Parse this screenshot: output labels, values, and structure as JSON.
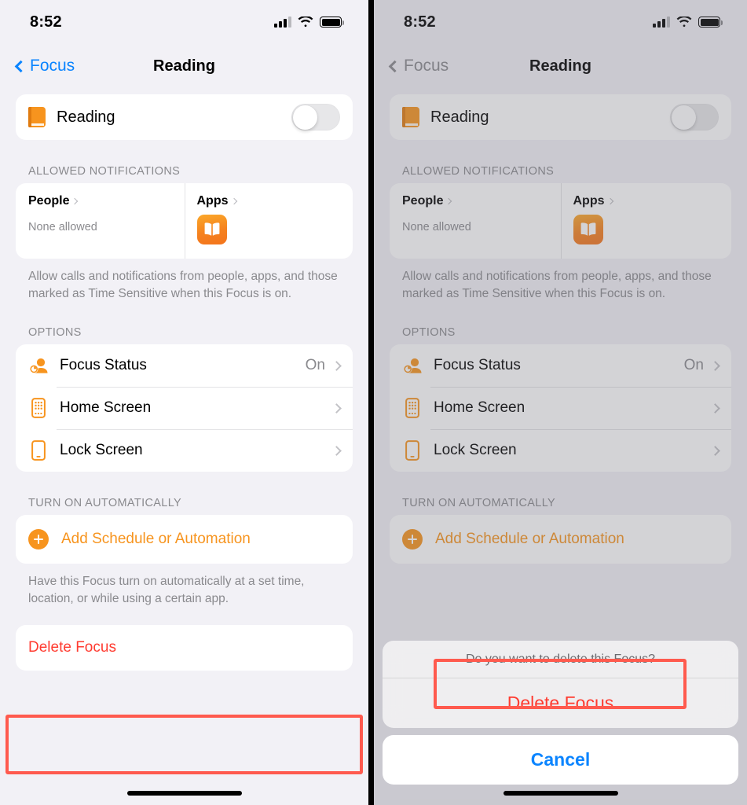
{
  "status_bar": {
    "time": "8:52",
    "cellular_icon": "cellular-bars-icon",
    "wifi_icon": "wifi-icon",
    "battery_icon": "battery-full-icon"
  },
  "nav": {
    "back_label": "Focus",
    "title": "Reading"
  },
  "focus_toggle": {
    "icon": "closed-book-icon",
    "label": "Reading",
    "state": "off"
  },
  "allowed_notifications": {
    "header": "ALLOWED NOTIFICATIONS",
    "people": {
      "title": "People",
      "subtitle": "None allowed"
    },
    "apps": {
      "title": "Apps",
      "app_icon": "books-app-icon"
    },
    "footnote": "Allow calls and notifications from people, apps, and those marked as Time Sensitive when this Focus is on."
  },
  "options": {
    "header": "OPTIONS",
    "items": [
      {
        "icon": "focus-status-icon",
        "label": "Focus Status",
        "value": "On"
      },
      {
        "icon": "home-screen-icon",
        "label": "Home Screen",
        "value": ""
      },
      {
        "icon": "lock-screen-icon",
        "label": "Lock Screen",
        "value": ""
      }
    ]
  },
  "turn_on_automatically": {
    "header": "TURN ON AUTOMATICALLY",
    "add_label": "Add Schedule or Automation",
    "add_icon": "plus-circle-icon",
    "footnote": "Have this Focus turn on automatically at a set time, location, or while using a certain app."
  },
  "delete": {
    "label": "Delete Focus"
  },
  "action_sheet": {
    "message": "Do you want to delete this Focus?",
    "confirm_label": "Delete Focus",
    "cancel_label": "Cancel"
  },
  "colors": {
    "accent_orange": "#f7941e",
    "destructive_red": "#ff3b30",
    "link_blue": "#0a84ff",
    "highlight_red": "#ff5a4e",
    "page_background": "#f2f1f6"
  }
}
